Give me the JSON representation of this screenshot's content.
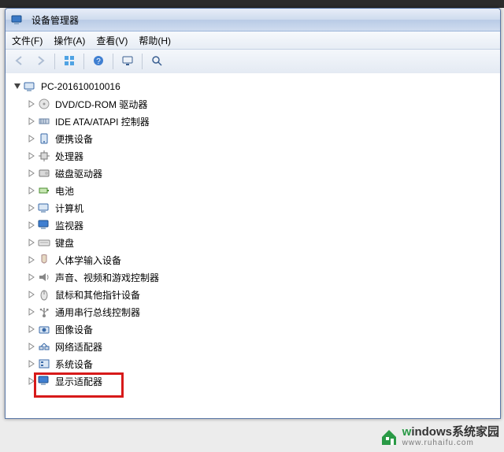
{
  "window": {
    "title": "设备管理器"
  },
  "menubar": {
    "items": [
      {
        "label": "文件(F)"
      },
      {
        "label": "操作(A)"
      },
      {
        "label": "查看(V)"
      },
      {
        "label": "帮助(H)"
      }
    ]
  },
  "toolbar": {
    "buttons": [
      {
        "name": "back-button",
        "icon": "arrow-left-icon",
        "enabled": false
      },
      {
        "name": "forward-button",
        "icon": "arrow-right-icon",
        "enabled": false
      },
      {
        "sep": true
      },
      {
        "name": "show-hidden-button",
        "icon": "grid-icon",
        "enabled": true
      },
      {
        "sep": true
      },
      {
        "name": "help-button",
        "icon": "help-icon",
        "enabled": true
      },
      {
        "sep": true
      },
      {
        "name": "properties-button",
        "icon": "monitor-icon",
        "enabled": true
      },
      {
        "sep": true
      },
      {
        "name": "scan-button",
        "icon": "scan-icon",
        "enabled": true
      }
    ]
  },
  "tree": {
    "root": {
      "label": "PC-201610010016",
      "icon": "computer-icon",
      "expanded": true
    },
    "nodes": [
      {
        "label": "DVD/CD-ROM 驱动器",
        "icon": "disc-icon"
      },
      {
        "label": "IDE ATA/ATAPI 控制器",
        "icon": "ata-icon"
      },
      {
        "label": "便携设备",
        "icon": "portable-icon"
      },
      {
        "label": "处理器",
        "icon": "cpu-icon"
      },
      {
        "label": "磁盘驱动器",
        "icon": "disk-icon"
      },
      {
        "label": "电池",
        "icon": "battery-icon"
      },
      {
        "label": "计算机",
        "icon": "computer-icon"
      },
      {
        "label": "监视器",
        "icon": "monitor-icon"
      },
      {
        "label": "键盘",
        "icon": "keyboard-icon"
      },
      {
        "label": "人体学输入设备",
        "icon": "hid-icon"
      },
      {
        "label": "声音、视频和游戏控制器",
        "icon": "sound-icon"
      },
      {
        "label": "鼠标和其他指针设备",
        "icon": "mouse-icon"
      },
      {
        "label": "通用串行总线控制器",
        "icon": "usb-icon"
      },
      {
        "label": "图像设备",
        "icon": "imaging-icon"
      },
      {
        "label": "网络适配器",
        "icon": "network-icon"
      },
      {
        "label": "系统设备",
        "icon": "system-icon"
      },
      {
        "label": "显示适配器",
        "icon": "display-icon",
        "highlighted": true
      }
    ]
  },
  "watermark": {
    "brand_prefix": "w",
    "brand": "indows",
    "brand_suffix": "系统家园",
    "sub": "www.ruhaifu.com"
  },
  "colors": {
    "highlight_border": "#d71a1a",
    "brand_green": "#2a9a46"
  }
}
